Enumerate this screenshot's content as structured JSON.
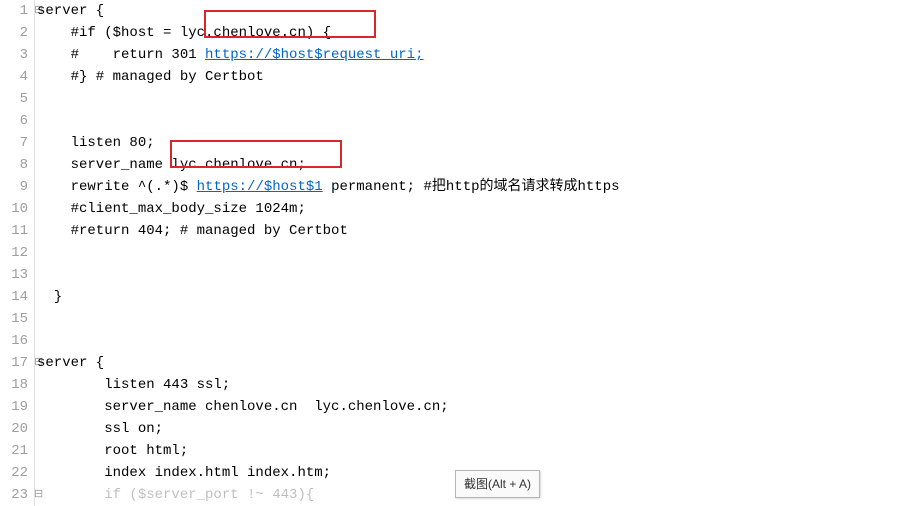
{
  "line_count": 23,
  "code": {
    "l1": "server {",
    "l2_pre": "    #if ($host = ",
    "l2_hl": "lyc.chenlove.cn)",
    "l2_post": " {",
    "l3_pre": "    #    return 301 ",
    "l3_link": "https://$host$request_uri;",
    "l4": "    #} # managed by Certbot",
    "l5": "",
    "l6": "",
    "l7": "    listen 80;",
    "l8_pre": "    server_name ",
    "l8_hl": "lyc.chenlove.cn;",
    "l9_pre": "    rewrite ^(.*)$ ",
    "l9_link": "https://$host$1",
    "l9_post": " permanent; #把http的域名请求转成https",
    "l10": "    #client_max_body_size 1024m;",
    "l11": "    #return 404; # managed by Certbot",
    "l12": "",
    "l13": "",
    "l14": "  }",
    "l15": "",
    "l16": "",
    "l17": "server {",
    "l18": "        listen 443 ssl;",
    "l19": "        server_name chenlove.cn  lyc.chenlove.cn;",
    "l20": "        ssl on;",
    "l21": "        root html;",
    "l22": "        index index.html index.htm;",
    "l23_partial": "        if ($server_port !~ 443){"
  },
  "tooltip_text": "截图(Alt + A)",
  "fold_marker": "⊟"
}
